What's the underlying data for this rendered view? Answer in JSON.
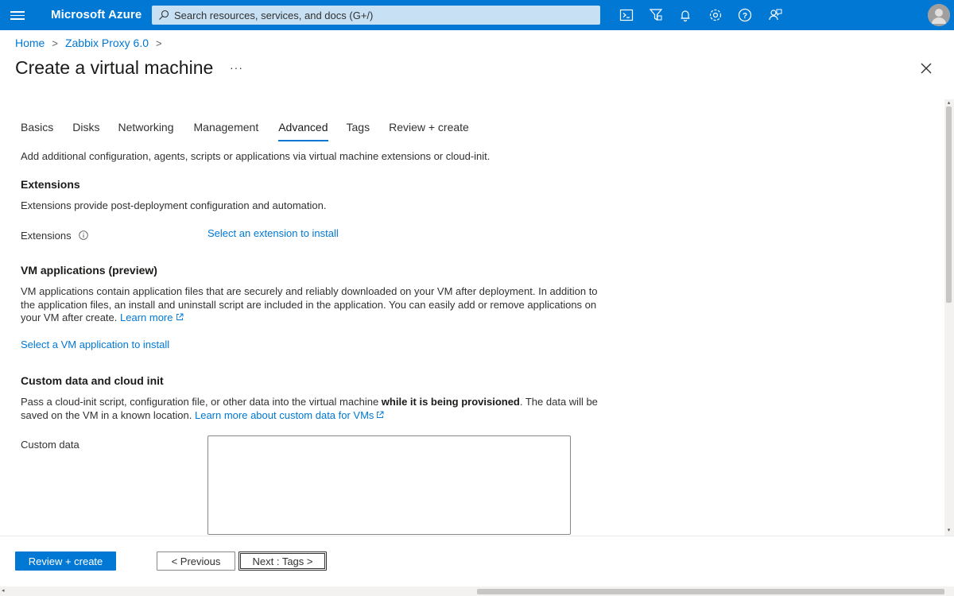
{
  "header": {
    "brand": "Microsoft Azure",
    "search_placeholder": "Search resources, services, and docs (G+/)",
    "icons": [
      "cloud-shell-icon",
      "directory-filter-icon",
      "notifications-icon",
      "settings-icon",
      "help-icon",
      "feedback-icon"
    ]
  },
  "breadcrumb": {
    "home": "Home",
    "item": "Zabbix Proxy 6.0"
  },
  "page": {
    "title": "Create a virtual machine",
    "more": "···"
  },
  "tabs": [
    {
      "label": "Basics"
    },
    {
      "label": "Disks"
    },
    {
      "label": "Networking"
    },
    {
      "label": "Management"
    },
    {
      "label": "Advanced",
      "active": true
    },
    {
      "label": "Tags"
    },
    {
      "label": "Review + create"
    }
  ],
  "advanced": {
    "intro": "Add additional configuration, agents, scripts or applications via virtual machine extensions or cloud-init.",
    "extensions": {
      "heading": "Extensions",
      "description": "Extensions provide post-deployment configuration and automation.",
      "field_label": "Extensions",
      "select_link": "Select an extension to install"
    },
    "vm_apps": {
      "heading": "VM applications (preview)",
      "line1": "VM applications contain application files that are securely and reliably downloaded on your VM after deployment. In addition to",
      "line2": "the application files, an install and uninstall script are included in the application. You can easily add or remove applications on",
      "line3": "your VM after create.",
      "learn_more": "Learn more",
      "select_link": "Select a VM application to install"
    },
    "custom_data": {
      "heading": "Custom data and cloud init",
      "line1_prefix": "Pass a cloud-init script, configuration file, or other data into the virtual machine ",
      "line1_bold": "while it is being provisioned",
      "line1_suffix": ". The data will be",
      "line2": "saved on the VM in a known location.",
      "learn_more": "Learn more about custom data for VMs",
      "field_label": "Custom data",
      "value": ""
    }
  },
  "footer": {
    "review_create": "Review + create",
    "previous": "< Previous",
    "next": "Next : Tags >"
  },
  "colors": {
    "topbar": "#0078d4",
    "accent": "#0078d4",
    "search_bg": "#c7e0f4"
  }
}
